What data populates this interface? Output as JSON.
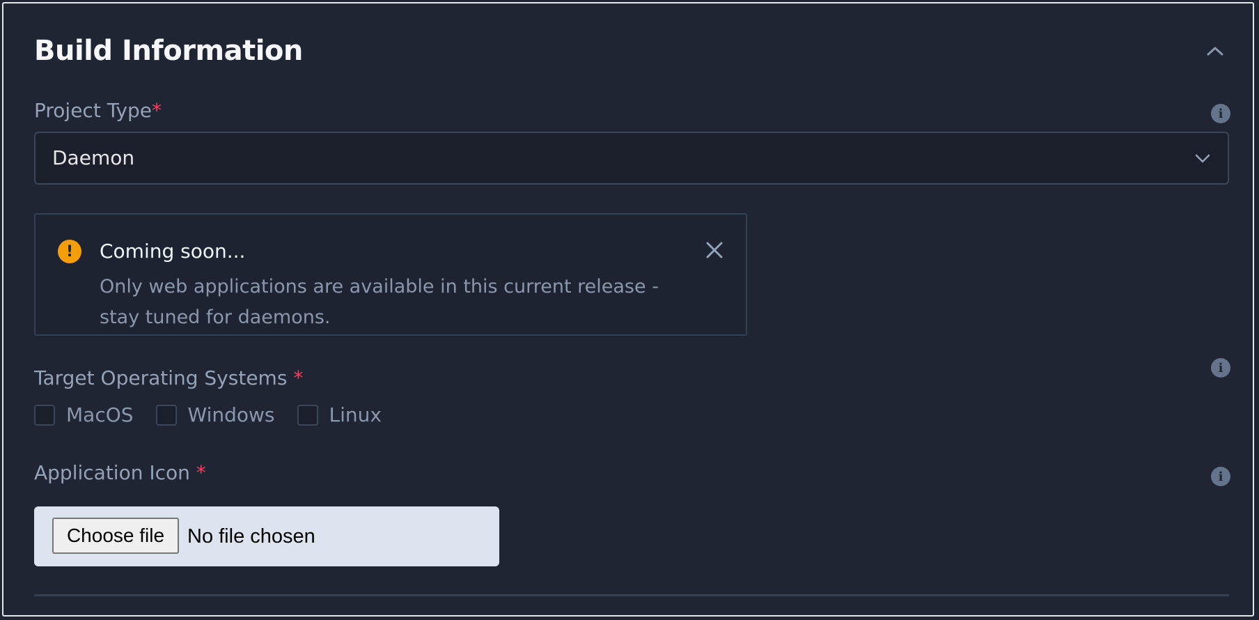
{
  "section": {
    "title": "Build Information",
    "collapse_icon": "chevron-up-icon"
  },
  "project_type": {
    "label": "Project Type",
    "required_mark": "*",
    "selected": "Daemon",
    "info_icon": "i"
  },
  "alert": {
    "title": "Coming soon...",
    "body": "Only web applications are available in this current release - stay tuned for daemons.",
    "icon_glyph": "!",
    "color": "#f59e0b"
  },
  "target_os": {
    "label": "Target Operating Systems",
    "required_mark": "*",
    "info_icon": "i",
    "options": [
      {
        "label": "MacOS",
        "checked": false
      },
      {
        "label": "Windows",
        "checked": false
      },
      {
        "label": "Linux",
        "checked": false
      }
    ]
  },
  "app_icon": {
    "label": "Application Icon",
    "required_mark": "*",
    "info_icon": "i",
    "button_label": "Choose file",
    "status": "No file chosen"
  },
  "colors": {
    "background": "#1f2532",
    "required": "#f43f5e",
    "warning": "#f59e0b"
  }
}
